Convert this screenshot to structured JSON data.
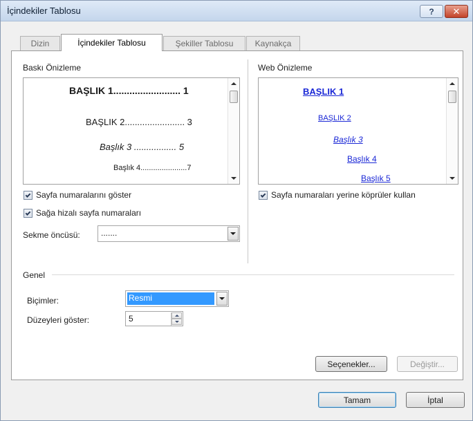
{
  "window": {
    "title": "İçindekiler Tablosu",
    "help_glyph": "?",
    "close_glyph": "✕"
  },
  "tabs": [
    {
      "label": "Dizin"
    },
    {
      "label": "İçindekiler Tablosu"
    },
    {
      "label": "Şekiller Tablosu"
    },
    {
      "label": "Kaynakça"
    }
  ],
  "print_preview": {
    "label": "Baskı Önizleme",
    "lines": [
      {
        "text": "BAŞLIK 1......................... 1"
      },
      {
        "text": "BAŞLIK 2........................ 3"
      },
      {
        "text": "Başlık 3 ................. 5"
      },
      {
        "text": "Başlık 4......................7"
      }
    ]
  },
  "web_preview": {
    "label": "Web Önizleme",
    "links": [
      {
        "text": "BAŞLIK 1"
      },
      {
        "text": "BAŞLIK 2"
      },
      {
        "text": "Başlık 3"
      },
      {
        "text": "Başlık 4"
      },
      {
        "text": "Başlık 5"
      }
    ]
  },
  "options": {
    "show_page_numbers": {
      "label": "Sayfa numaralarını göster",
      "checked": true
    },
    "right_align_page_numbers": {
      "label": "Sağa hizalı sayfa numaraları",
      "checked": true
    },
    "use_hyperlinks": {
      "label": "Sayfa numaraları yerine köprüler kullan",
      "checked": true
    },
    "tab_leader": {
      "label": "Sekme öncüsü:",
      "value": "......."
    }
  },
  "general": {
    "label": "Genel",
    "formats": {
      "label": "Biçimler:",
      "value": "Resmi"
    },
    "show_levels": {
      "label": "Düzeyleri göster:",
      "value": "5"
    }
  },
  "buttons": {
    "options": "Seçenekler...",
    "modify": "Değiştir...",
    "ok": "Tamam",
    "cancel": "İptal"
  },
  "colors": {
    "link": "#1a27d6",
    "selection": "#3399ff"
  }
}
